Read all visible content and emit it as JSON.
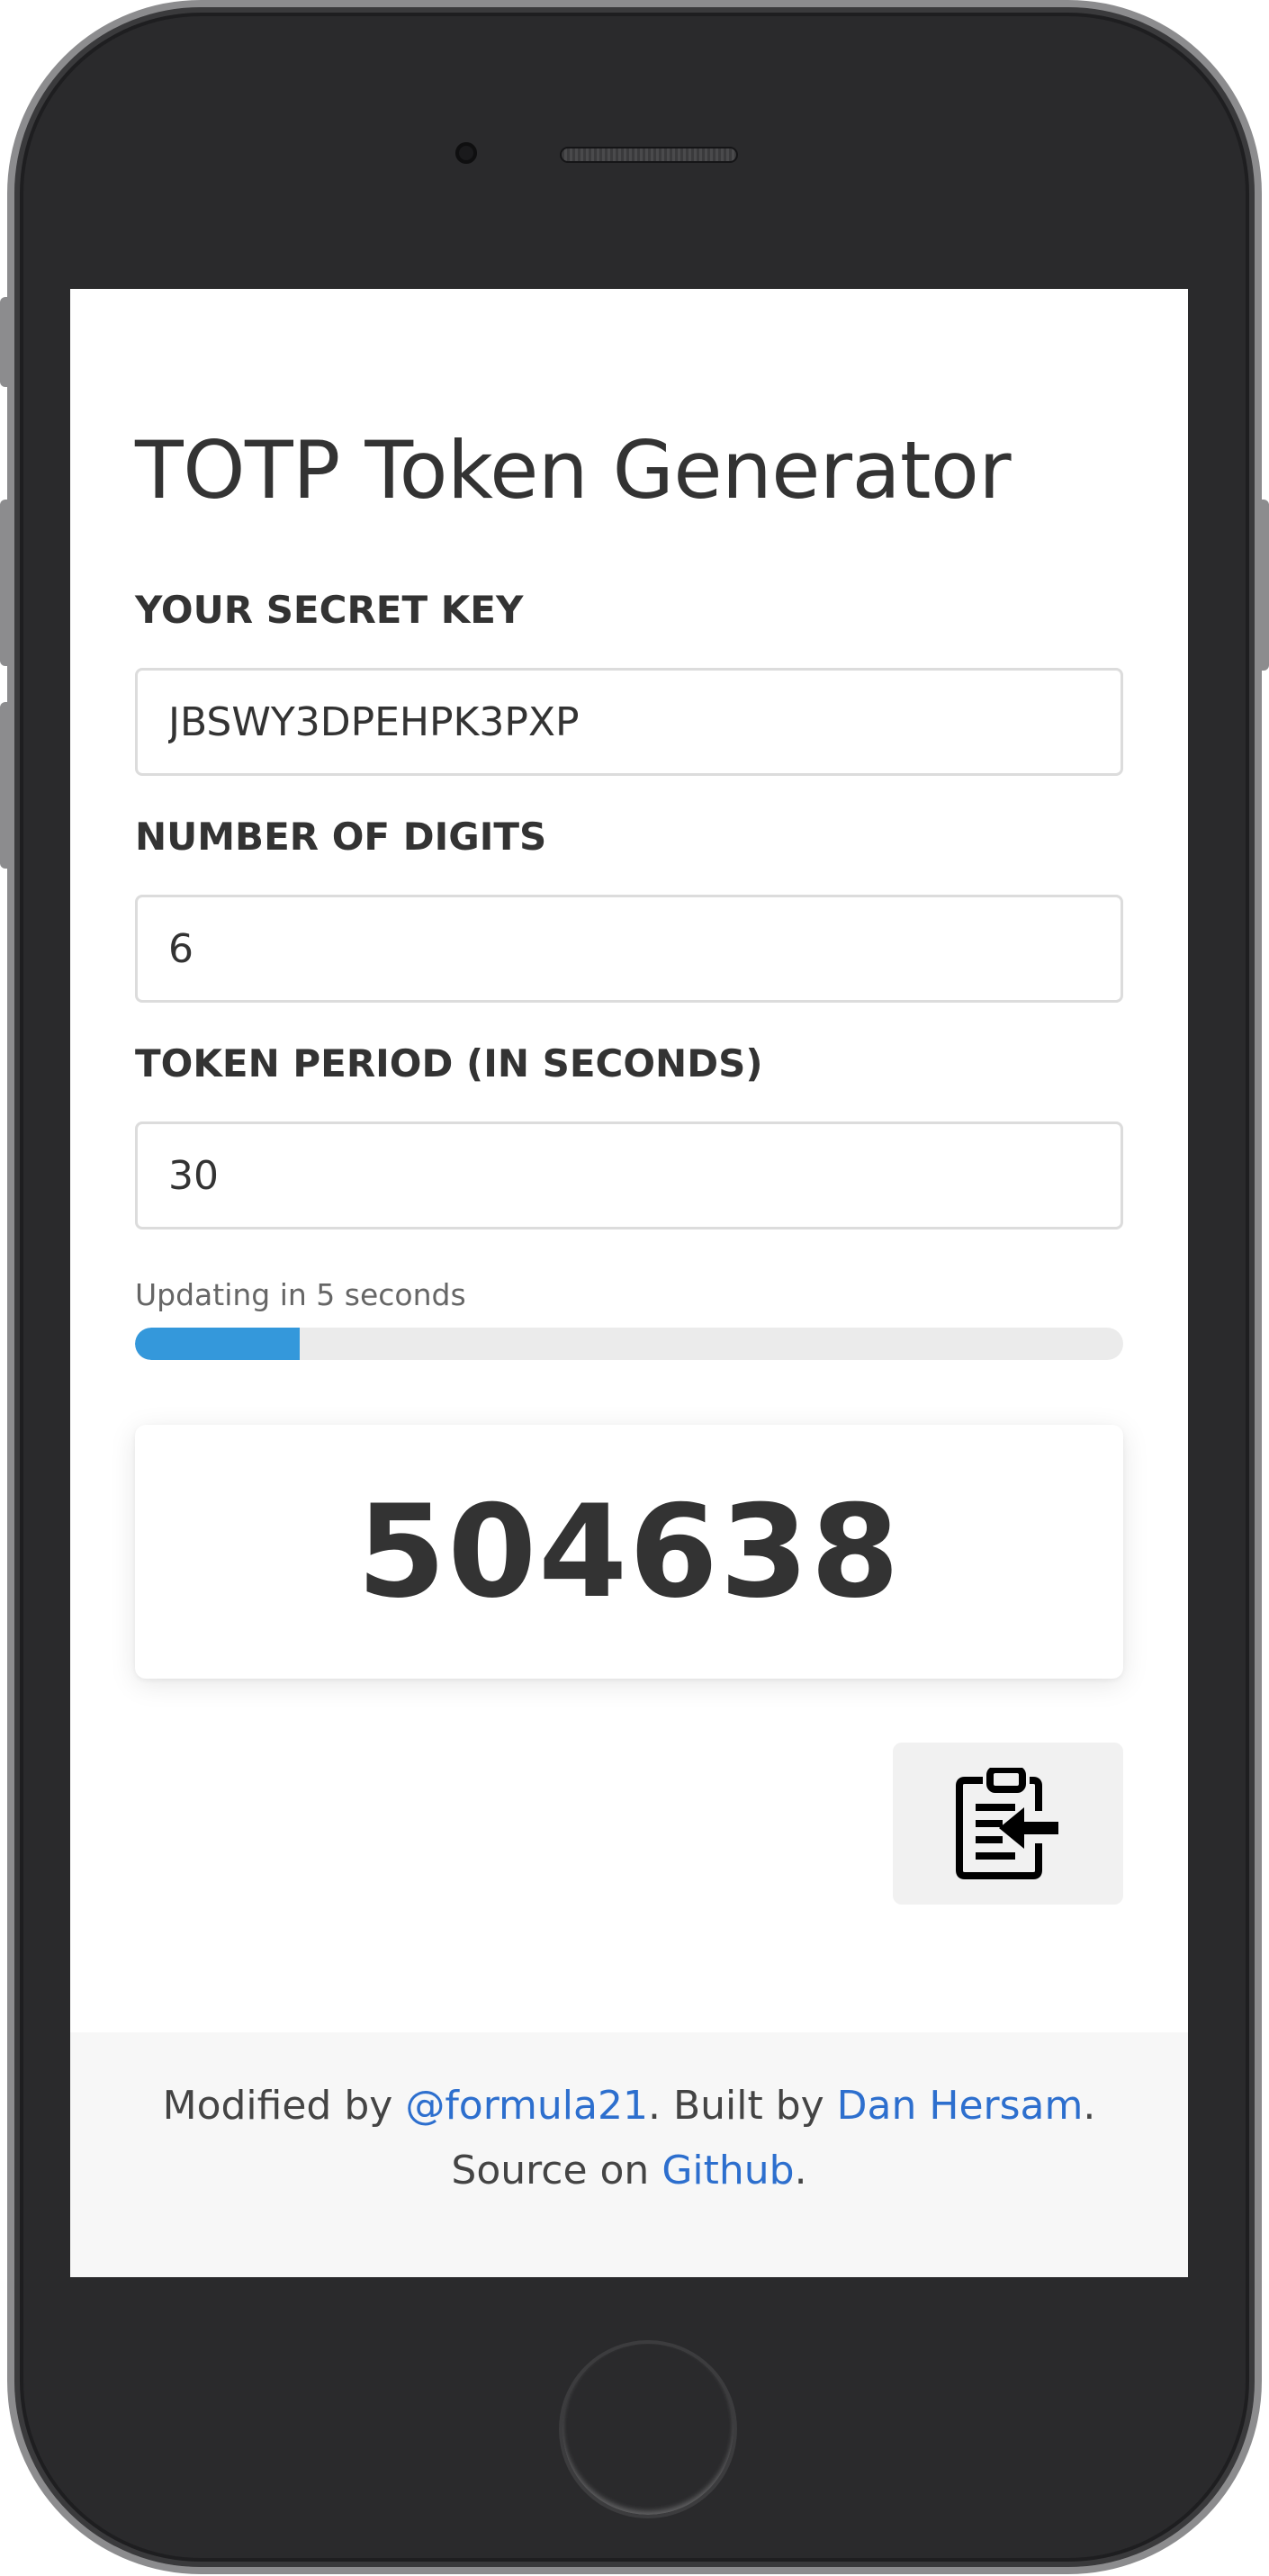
{
  "app": {
    "title": "TOTP Token Generator"
  },
  "form": {
    "secret_label": "YOUR SECRET KEY",
    "secret_value": "JBSWY3DPEHPK3PXP",
    "digits_label": "NUMBER OF DIGITS",
    "digits_value": "6",
    "period_label": "TOKEN PERIOD (IN SECONDS)",
    "period_value": "30"
  },
  "progress": {
    "text": "Updating in 5 seconds",
    "remaining_seconds": 5,
    "period_seconds": 30,
    "fill_percent": 16.7,
    "color": "#3498db"
  },
  "token": {
    "value": "504638"
  },
  "copy_button": {
    "icon": "clipboard-copy-icon"
  },
  "footer": {
    "modified_prefix": "Modified by ",
    "modified_link": "@formula21",
    "built_prefix": ". Built by ",
    "built_link": "Dan Hersam",
    "built_suffix": ".",
    "source_prefix": "Source on ",
    "source_link": "Github",
    "source_suffix": ".",
    "link_color": "#2d6fce"
  }
}
